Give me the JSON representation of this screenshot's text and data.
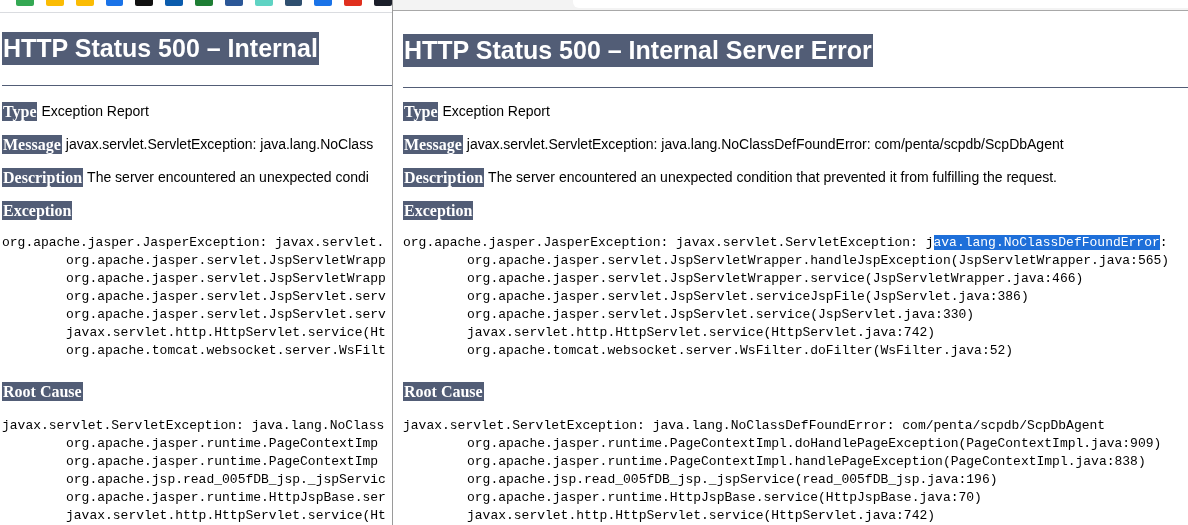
{
  "windows": [
    {
      "kind": "back",
      "title": "HTTP Status 500 – Internal",
      "type_label": "Type",
      "type_value": "Exception Report",
      "message_label": "Message",
      "message_value": "javax.servlet.ServletException: java.lang.NoClass",
      "description_label": "Description",
      "description_value": "The server encountered an unexpected condi",
      "exception_label": "Exception",
      "exception_head": [
        {
          "text": "org.apache.jasper.JasperException: javax.servlet.",
          "selected": false
        }
      ],
      "exception_frames": [
        "org.apache.jasper.servlet.JspServletWrapp",
        "org.apache.jasper.servlet.JspServletWrapp",
        "org.apache.jasper.servlet.JspServlet.serv",
        "org.apache.jasper.servlet.JspServlet.serv",
        "javax.servlet.http.HttpServlet.service(Ht",
        "org.apache.tomcat.websocket.server.WsFilt"
      ],
      "root_cause_label": "Root Cause",
      "root_cause_head": [
        {
          "text": "javax.servlet.ServletException: java.lang.NoClass",
          "selected": false
        }
      ],
      "root_cause_frames": [
        "org.apache.jasper.runtime.PageContextImp",
        "org.apache.jasper.runtime.PageContextImp",
        "org.apache.jsp.read_005fDB_jsp._jspServic",
        "org.apache.jasper.runtime.HttpJspBase.ser",
        "javax.servlet.http.HttpServlet.service(Ht"
      ]
    },
    {
      "kind": "front",
      "title": "HTTP Status 500 – Internal Server Error",
      "type_label": "Type",
      "type_value": "Exception Report",
      "message_label": "Message",
      "message_value": "javax.servlet.ServletException: java.lang.NoClassDefFoundError: com/penta/scpdb/ScpDbAgent",
      "description_label": "Description",
      "description_value": "The server encountered an unexpected condition that prevented it from fulfilling the request.",
      "exception_label": "Exception",
      "exception_head": [
        {
          "text": "org.apache.jasper.JasperException: javax.servlet.ServletException: j",
          "selected": false
        },
        {
          "text": "ava.lang.NoClassDefFoundError",
          "selected": true
        },
        {
          "text": ":",
          "selected": false
        }
      ],
      "exception_frames": [
        "org.apache.jasper.servlet.JspServletWrapper.handleJspException(JspServletWrapper.java:565)",
        "org.apache.jasper.servlet.JspServletWrapper.service(JspServletWrapper.java:466)",
        "org.apache.jasper.servlet.JspServlet.serviceJspFile(JspServlet.java:386)",
        "org.apache.jasper.servlet.JspServlet.service(JspServlet.java:330)",
        "javax.servlet.http.HttpServlet.service(HttpServlet.java:742)",
        "org.apache.tomcat.websocket.server.WsFilter.doFilter(WsFilter.java:52)"
      ],
      "root_cause_label": "Root Cause",
      "root_cause_head": [
        {
          "text": "javax.servlet.ServletException: java.lang.NoClassDefFoundError: com/penta/scpdb/ScpDbAgent",
          "selected": false
        }
      ],
      "root_cause_frames": [
        "org.apache.jasper.runtime.PageContextImpl.doHandlePageException(PageContextImpl.java:909)",
        "org.apache.jasper.runtime.PageContextImpl.handlePageException(PageContextImpl.java:838)",
        "org.apache.jsp.read_005fDB_jsp._jspService(read_005fDB_jsp.java:196)",
        "org.apache.jasper.runtime.HttpJspBase.service(HttpJspBase.java:70)",
        "javax.servlet.http.HttpServlet.service(HttpServlet.java:742)"
      ]
    }
  ]
}
